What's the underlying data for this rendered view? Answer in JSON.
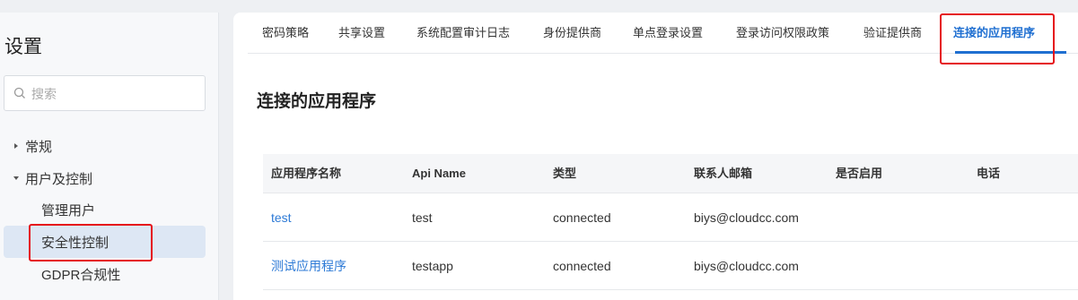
{
  "sidebar": {
    "title": "设置",
    "search_placeholder": "搜索",
    "items": [
      {
        "label": "常规",
        "expanded": false
      },
      {
        "label": "用户及控制",
        "expanded": true,
        "children": [
          {
            "label": "管理用户"
          },
          {
            "label": "安全性控制",
            "active": true
          },
          {
            "label": "GDPR合规性"
          }
        ]
      }
    ]
  },
  "tabs": [
    {
      "label": "密码策略"
    },
    {
      "label": "共享设置"
    },
    {
      "label": "系统配置审计日志"
    },
    {
      "label": "身份提供商"
    },
    {
      "label": "单点登录设置"
    },
    {
      "label": "登录访问权限政策"
    },
    {
      "label": "验证提供商"
    },
    {
      "label": "连接的应用程序",
      "active": true
    }
  ],
  "page_title": "连接的应用程序",
  "table": {
    "columns": [
      "应用程序名称",
      "Api Name",
      "类型",
      "联系人邮箱",
      "是否启用",
      "电话"
    ],
    "rows": [
      {
        "name": "test",
        "api_name": "test",
        "type": "connected",
        "email": "biys@cloudcc.com",
        "enabled": "",
        "phone": ""
      },
      {
        "name": "测试应用程序",
        "api_name": "testapp",
        "type": "connected",
        "email": "biys@cloudcc.com",
        "enabled": "",
        "phone": ""
      }
    ]
  },
  "colors": {
    "accent": "#1f6fd1",
    "link": "#2d7ad6",
    "highlight_box": "#e5121a",
    "active_sidebar_bg": "#dde7f4"
  }
}
